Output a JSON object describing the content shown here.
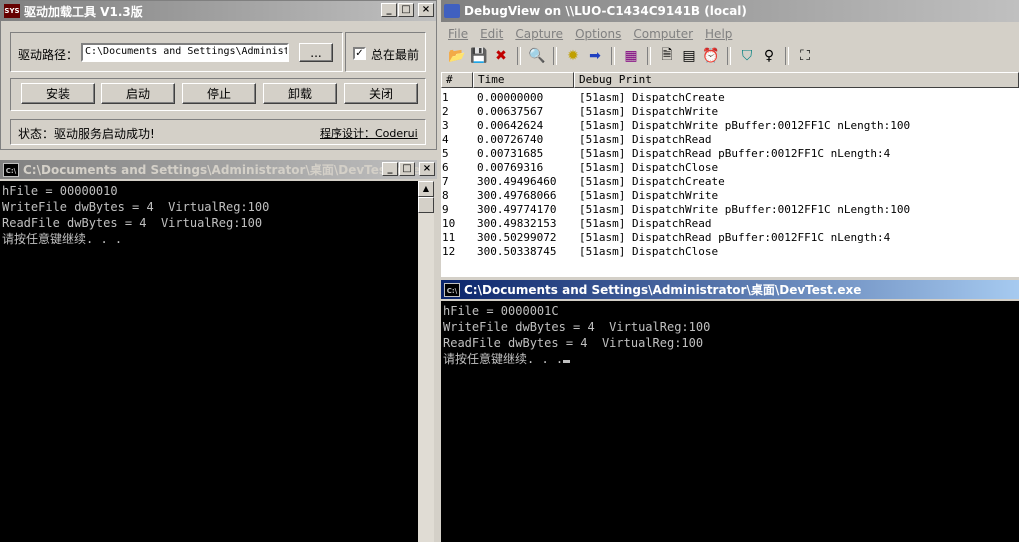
{
  "loader": {
    "title": "驱动加载工具 V1.3版",
    "icon": "SYS",
    "path_label": "驱动路径：",
    "path_value": "C:\\Documents and Settings\\Administ:",
    "browse_label": "...",
    "topmost_label": "总在最前",
    "topmost_checked": true,
    "buttons": [
      "安装",
      "启动",
      "停止",
      "卸载",
      "关闭"
    ],
    "status": "状态：驱动服务启动成功!",
    "credit": "程序设计：Coderui"
  },
  "console1": {
    "title": "C:\\Documents and Settings\\Administrator\\桌面\\DevTest.exe",
    "icon": "C:\\",
    "lines": [
      "hFile = 00000010",
      "WriteFile dwBytes = 4  VirtualReg:100",
      "ReadFile dwBytes = 4  VirtualReg:100",
      "请按任意键继续. . ."
    ]
  },
  "debugview": {
    "title": "DebugView on \\\\LUO-C1434C9141B (local)",
    "menu": [
      "File",
      "Edit",
      "Capture",
      "Options",
      "Computer",
      "Help"
    ],
    "columns": [
      "#",
      "Time",
      "Debug Print"
    ],
    "rows": [
      {
        "n": "1",
        "time": "0.00000000",
        "msg": "[51asm] DispatchCreate"
      },
      {
        "n": "2",
        "time": "0.00637567",
        "msg": "[51asm] DispatchWrite"
      },
      {
        "n": "3",
        "time": "0.00642624",
        "msg": "[51asm] DispatchWrite pBuffer:0012FF1C nLength:100"
      },
      {
        "n": "4",
        "time": "0.00726740",
        "msg": "[51asm] DispatchRead"
      },
      {
        "n": "5",
        "time": "0.00731685",
        "msg": "[51asm] DispatchRead pBuffer:0012FF1C nLength:4"
      },
      {
        "n": "6",
        "time": "0.00769316",
        "msg": "[51asm] DispatchClose"
      },
      {
        "n": "7",
        "time": "300.49496460",
        "msg": "[51asm] DispatchCreate"
      },
      {
        "n": "8",
        "time": "300.49768066",
        "msg": "[51asm] DispatchWrite"
      },
      {
        "n": "9",
        "time": "300.49774170",
        "msg": "[51asm] DispatchWrite pBuffer:0012FF1C nLength:100"
      },
      {
        "n": "10",
        "time": "300.49832153",
        "msg": "[51asm] DispatchRead"
      },
      {
        "n": "11",
        "time": "300.50299072",
        "msg": "[51asm] DispatchRead pBuffer:0012FF1C nLength:4"
      },
      {
        "n": "12",
        "time": "300.50338745",
        "msg": "[51asm] DispatchClose"
      }
    ]
  },
  "console2": {
    "title": "C:\\Documents and Settings\\Administrator\\桌面\\DevTest.exe",
    "icon": "C:\\",
    "lines": [
      "hFile = 0000001C",
      "WriteFile dwBytes = 4  VirtualReg:100",
      "ReadFile dwBytes = 4  VirtualReg:100",
      "请按任意键继续. . ."
    ]
  },
  "window_buttons": {
    "minimize": "_",
    "maximize": "□",
    "close": "×"
  }
}
